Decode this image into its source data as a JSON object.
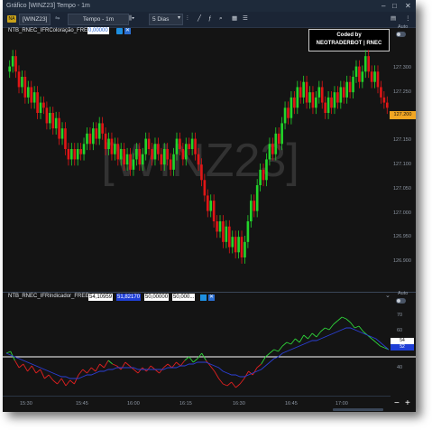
{
  "window": {
    "title": "Gráfico [WINZ23]  Tempo - 1m",
    "controls": [
      "–",
      "□",
      "✕"
    ]
  },
  "toolbar": {
    "badge": "NA",
    "symbol": "[WINZ23]",
    "timeframe": "Tempo - 1m",
    "period": "5 Dias"
  },
  "watermark": "[WINZ23]",
  "price_panel": {
    "indicator_name": "NTB_RNEC_IFRColoração_FREE",
    "indicator_value": "0,00000",
    "coded_by_line1": "Coded by",
    "coded_by_line2": "NEOTRADERBOT | RNEC",
    "auto_label": "Auto",
    "price_labels": [
      "127.300",
      "127.250",
      "127.200",
      "127.150",
      "127.100",
      "127.050",
      "127.000",
      "126.950",
      "126.900"
    ],
    "current_price": "127.200"
  },
  "osc_panel": {
    "indicator_name": "NTB_RNEC_IFRIndicador_FREE",
    "values": [
      "54,10959",
      "51,82170",
      "50,00000",
      "50,000..."
    ],
    "auto_label": "Auto",
    "labels": [
      "70",
      "60",
      "40"
    ],
    "current_badges": [
      "54",
      "52"
    ]
  },
  "time_axis": [
    "15:30",
    "15:45",
    "16:00",
    "16:15",
    "16:30",
    "16:45",
    "17:00"
  ],
  "colors": {
    "up": "#22d42a",
    "down": "#e01616",
    "osc_green": "#2fd43a",
    "osc_blue": "#2b3fd6",
    "osc_red": "#e02020",
    "accent": "#1e8fe0",
    "price_badge": "#f2a622"
  },
  "chart_data": {
    "type": "candlestick",
    "price_ylim": [
      126.875,
      127.33
    ],
    "closes": [
      127.28,
      127.3,
      127.27,
      127.24,
      127.26,
      127.22,
      127.24,
      127.21,
      127.23,
      127.19,
      127.21,
      127.2,
      127.17,
      127.19,
      127.16,
      127.18,
      127.14,
      127.16,
      127.12,
      127.1,
      127.12,
      127.1,
      127.12,
      127.11,
      127.13,
      127.15,
      127.13,
      127.16,
      127.14,
      127.17,
      127.15,
      127.12,
      127.14,
      127.11,
      127.13,
      127.1,
      127.12,
      127.09,
      127.11,
      127.08,
      127.1,
      127.12,
      127.09,
      127.11,
      127.14,
      127.12,
      127.1,
      127.13,
      127.11,
      127.09,
      127.12,
      127.1,
      127.08,
      127.11,
      127.14,
      127.12,
      127.1,
      127.13,
      127.12,
      127.14,
      127.11,
      127.09,
      127.06,
      127.03,
      127.0,
      127.02,
      126.98,
      126.96,
      126.98,
      126.94,
      126.97,
      126.93,
      126.95,
      126.92,
      126.95,
      126.91,
      126.94,
      126.98,
      127.02,
      127.0,
      127.05,
      127.08,
      127.06,
      127.1,
      127.13,
      127.11,
      127.15,
      127.13,
      127.17,
      127.2,
      127.18,
      127.22,
      127.2,
      127.24,
      127.22,
      127.25,
      127.21,
      127.23,
      127.2,
      127.22,
      127.24,
      127.21,
      127.19,
      127.22,
      127.2,
      127.23,
      127.21,
      127.24,
      127.22,
      127.25,
      127.23,
      127.26,
      127.28,
      127.25,
      127.27,
      127.3,
      127.27,
      127.25,
      127.27,
      127.24,
      127.22,
      127.21,
      127.2
    ],
    "osc_ylim": [
      30,
      80
    ],
    "osc_series": [
      {
        "name": "green",
        "values": [
          52,
          53,
          48,
          44,
          46,
          42,
          45,
          41,
          43,
          38,
          40,
          37,
          35,
          38,
          34,
          37,
          35,
          40,
          43,
          41,
          44,
          42,
          46,
          44,
          48,
          46,
          45,
          43,
          47,
          45,
          43,
          41,
          44,
          42,
          45,
          43,
          41,
          44,
          46,
          44,
          47,
          45,
          48,
          50,
          47,
          49,
          52,
          48,
          45,
          42,
          38,
          35,
          34,
          36,
          33,
          35,
          38,
          42,
          40,
          44,
          46,
          50,
          52,
          54,
          53,
          56,
          58,
          57,
          60,
          58,
          62,
          60,
          63,
          61,
          64,
          66,
          65,
          68,
          70,
          72,
          71,
          69,
          66,
          67,
          64,
          62,
          60,
          58,
          56,
          55,
          54
        ]
      },
      {
        "name": "blue",
        "values": [
          52,
          51,
          50,
          49,
          48,
          47,
          46,
          45,
          44,
          43,
          42,
          41,
          40,
          39,
          39,
          38,
          38,
          38,
          39,
          40,
          40,
          41,
          42,
          42,
          43,
          43,
          44,
          44,
          44,
          44,
          44,
          43,
          43,
          43,
          43,
          43,
          43,
          43,
          44,
          44,
          44,
          45,
          45,
          46,
          46,
          47,
          47,
          47,
          46,
          45,
          44,
          42,
          41,
          40,
          40,
          39,
          39,
          40,
          41,
          42,
          43,
          45,
          47,
          49,
          50,
          52,
          53,
          54,
          55,
          56,
          57,
          58,
          59,
          59,
          60,
          61,
          62,
          63,
          64,
          65,
          66,
          66,
          65,
          64,
          63,
          62,
          61,
          60,
          58,
          56,
          54
        ]
      }
    ],
    "osc_reference": 50
  }
}
